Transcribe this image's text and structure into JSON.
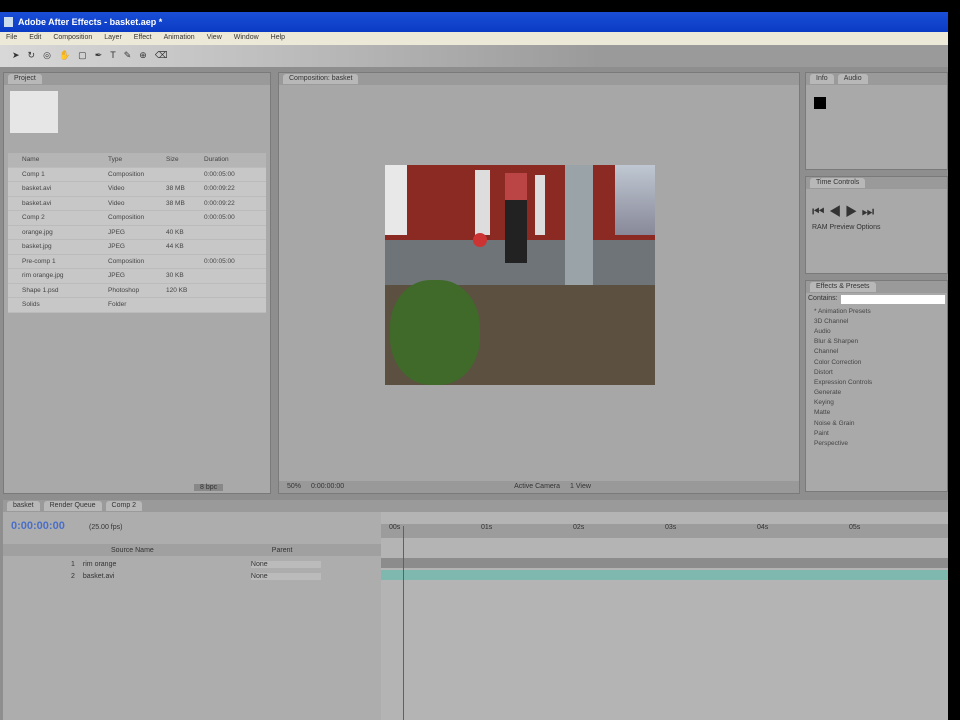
{
  "app": {
    "title": "Adobe After Effects - basket.aep *"
  },
  "menu": [
    "File",
    "Edit",
    "Composition",
    "Layer",
    "Effect",
    "Animation",
    "View",
    "Window",
    "Help"
  ],
  "tools": [
    "selection-tool",
    "rotation-tool",
    "camera-tool",
    "pan-tool",
    "mask-tool",
    "pen-tool",
    "type-tool",
    "brush-tool",
    "clone-tool",
    "eraser-tool"
  ],
  "project": {
    "tab": "Project",
    "columns": [
      "Name",
      "Type",
      "Size",
      "Duration"
    ],
    "items": [
      {
        "name": "Comp 1",
        "type": "Composition",
        "size": "",
        "duration": "0:00:05:00"
      },
      {
        "name": "basket.avi",
        "type": "Video",
        "size": "38 MB",
        "duration": "0:00:09:22"
      },
      {
        "name": "basket.avi",
        "type": "Video",
        "size": "38 MB",
        "duration": "0:00:09:22"
      },
      {
        "name": "Comp 2",
        "type": "Composition",
        "size": "",
        "duration": "0:00:05:00"
      },
      {
        "name": "orange.jpg",
        "type": "JPEG",
        "size": "40 KB",
        "duration": ""
      },
      {
        "name": "basket.jpg",
        "type": "JPEG",
        "size": "44 KB",
        "duration": ""
      },
      {
        "name": "Pre-comp 1",
        "type": "Composition",
        "size": "",
        "duration": "0:00:05:00"
      },
      {
        "name": "rim orange.jpg",
        "type": "JPEG",
        "size": "30 KB",
        "duration": ""
      },
      {
        "name": "Shape 1.psd",
        "type": "Photoshop",
        "size": "120 KB",
        "duration": ""
      },
      {
        "name": "Solids",
        "type": "Folder",
        "size": "",
        "duration": ""
      }
    ],
    "footer": "8 bpc"
  },
  "composition": {
    "tab": "Composition: basket",
    "zoom": "50%",
    "timecode": "0:00:00:00",
    "view": "Active Camera",
    "views": "1 View"
  },
  "info": {
    "tab": "Info",
    "tab2": "Audio"
  },
  "preview": {
    "tab": "Time Controls",
    "ram_preview": "RAM Preview Options"
  },
  "effects": {
    "tab": "Effects & Presets",
    "contains_label": "Contains:",
    "search": "",
    "items": [
      "* Animation Presets",
      "3D Channel",
      "Audio",
      "Blur & Sharpen",
      "Channel",
      "Color Correction",
      "Distort",
      "Expression Controls",
      "Generate",
      "Keying",
      "Matte",
      "Noise & Grain",
      "Paint",
      "Perspective"
    ]
  },
  "timeline": {
    "tabs": [
      "basket",
      "Render Queue",
      "Comp 2"
    ],
    "timecode": "0:00:00:00",
    "fps": "(25.00 fps)",
    "col_source": "Source Name",
    "col_parent": "Parent",
    "layers": [
      {
        "num": "1",
        "name": "rim orange",
        "parent": "None"
      },
      {
        "num": "2",
        "name": "basket.avi",
        "parent": "None"
      }
    ],
    "ruler": [
      "00s",
      "01s",
      "02s",
      "03s",
      "04s",
      "05s"
    ]
  }
}
